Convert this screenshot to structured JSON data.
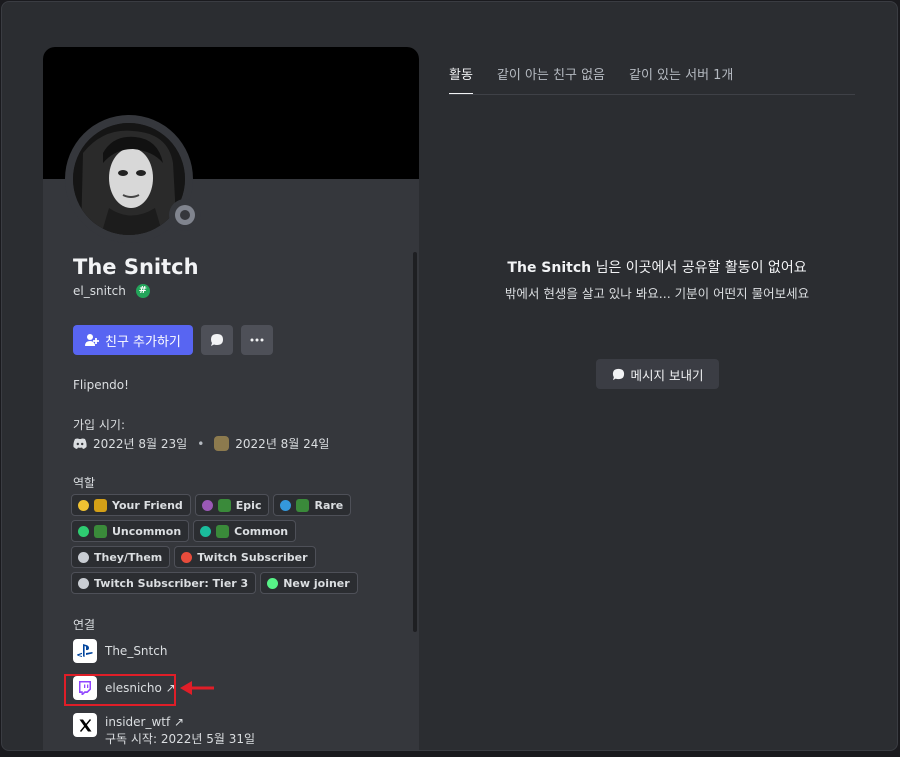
{
  "profile": {
    "display_name": "The Snitch",
    "username": "el_snitch",
    "badge_glyph": "#",
    "add_friend_label": "친구 추가하기",
    "bio": "Flipendo!",
    "joined_label": "가입 시기:",
    "joined_discord": "2022년 8월 23일",
    "joined_server": "2022년 8월 24일",
    "separator": "•",
    "roles_label": "역할",
    "connections_label": "연결"
  },
  "roles": [
    {
      "name": "Your Friend",
      "color": "#f0c232",
      "emoji": "check-shield"
    },
    {
      "name": "Epic",
      "color": "#9b59b6",
      "emoji": "pepe"
    },
    {
      "name": "Rare",
      "color": "#3498db",
      "emoji": "pepe"
    },
    {
      "name": "Uncommon",
      "color": "#2ecc71",
      "emoji": "pepe"
    },
    {
      "name": "Common",
      "color": "#1abc9c",
      "emoji": "pepe"
    },
    {
      "name": "They/Them",
      "color": "#c9cdd3",
      "emoji": ""
    },
    {
      "name": "Twitch Subscriber",
      "color": "#e74c3c",
      "emoji": ""
    },
    {
      "name": "Twitch Subscriber: Tier 3",
      "color": "#c9cdd3",
      "emoji": ""
    },
    {
      "name": "New joiner",
      "color": "#57f287",
      "emoji": ""
    }
  ],
  "connections": [
    {
      "service": "playstation-icon",
      "account": "The_Sntch",
      "sub": ""
    },
    {
      "service": "twitch-icon",
      "account": "elesnicho ↗",
      "sub": ""
    },
    {
      "service": "x-icon",
      "account": "insider_wtf ↗",
      "sub": "구독 시작: 2022년 5월 31일"
    }
  ],
  "tabs": [
    {
      "label": "활동",
      "active": true
    },
    {
      "label": "같이 아는 친구 없음",
      "active": false
    },
    {
      "label": "같이 있는 서버 1개",
      "active": false
    }
  ],
  "activity": {
    "empty_name": "The Snitch",
    "empty_title_rest": " 님은 이곳에서 공유할 활동이 없어요",
    "empty_sub": "밖에서 현생을 살고 있나 봐요... 기분이 어떤지 물어보세요",
    "message_button": "메시지 보내기"
  },
  "colors": {
    "accent": "#5865f2",
    "highlight": "#e01e28"
  }
}
